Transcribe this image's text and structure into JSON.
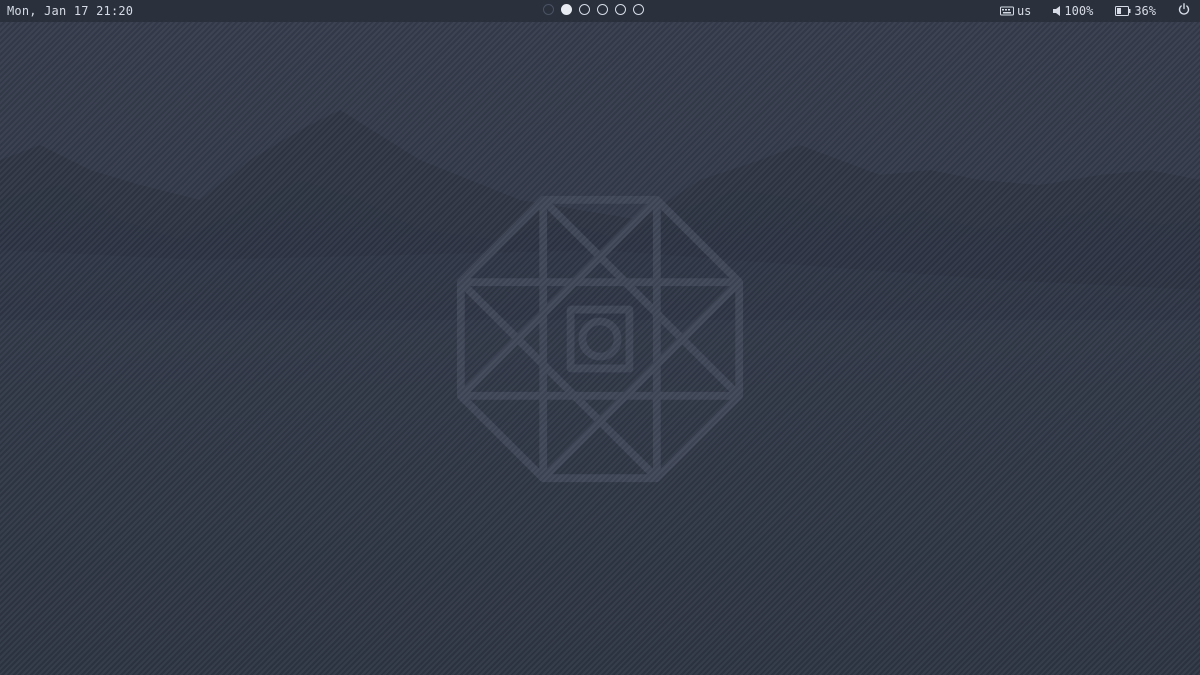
{
  "topbar": {
    "clock": "Mon, Jan 17 21:20",
    "workspaces": [
      {
        "state": "empty"
      },
      {
        "state": "active"
      },
      {
        "state": "occupied"
      },
      {
        "state": "occupied"
      },
      {
        "state": "occupied"
      },
      {
        "state": "occupied"
      }
    ],
    "tray": {
      "keyboard_layout": "us",
      "volume": "100%",
      "battery": "36%",
      "keyboard_icon": "keyboard-icon",
      "volume_icon": "speaker-icon",
      "battery_icon": "battery-icon",
      "power_icon": "power-icon"
    }
  },
  "colors": {
    "bar_background": "#2a303c",
    "bar_text": "#d6dbe5",
    "wallpaper": "#313848",
    "logo_stroke": "#3f4657"
  }
}
